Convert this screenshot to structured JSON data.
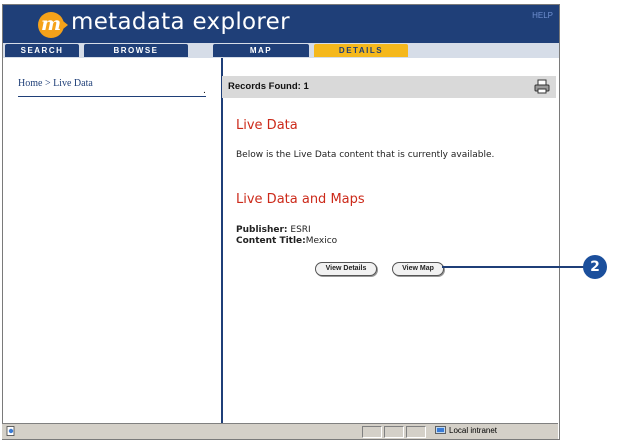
{
  "header": {
    "logo_letter": "m",
    "app_title": "metadata explorer",
    "help_label": "HELP"
  },
  "tabs": [
    {
      "label": "SEARCH",
      "active": false
    },
    {
      "label": "BROWSE",
      "active": false
    },
    {
      "label": "MAP",
      "active": false
    },
    {
      "label": "DETAILS",
      "active": true
    }
  ],
  "left_pane": {
    "breadcrumb": "Home > Live Data",
    "marker": "."
  },
  "results": {
    "records_found": "Records Found: 1",
    "print_icon": "printer-icon"
  },
  "detail": {
    "heading": "Live Data",
    "description": "Below is the Live Data content that is currently available.",
    "subheading": "Live Data and Maps",
    "publisher_label": "Publisher:",
    "publisher_value": "ESRI",
    "content_title_label": "Content Title:",
    "content_title_value": "Mexico",
    "view_details_button": "View Details",
    "view_map_button": "View Map"
  },
  "callout": {
    "number": "2"
  },
  "statusbar": {
    "zone_text": "Local intranet",
    "page_icon": "ie-page-icon",
    "zone_icon": "intranet-icon"
  },
  "colors": {
    "header_blue": "#1f3f78",
    "tab_active": "#f5b81c",
    "logo_orange": "#f5a21a",
    "heading_red": "#cc2a1a",
    "callout_blue": "#1b4f9c"
  }
}
